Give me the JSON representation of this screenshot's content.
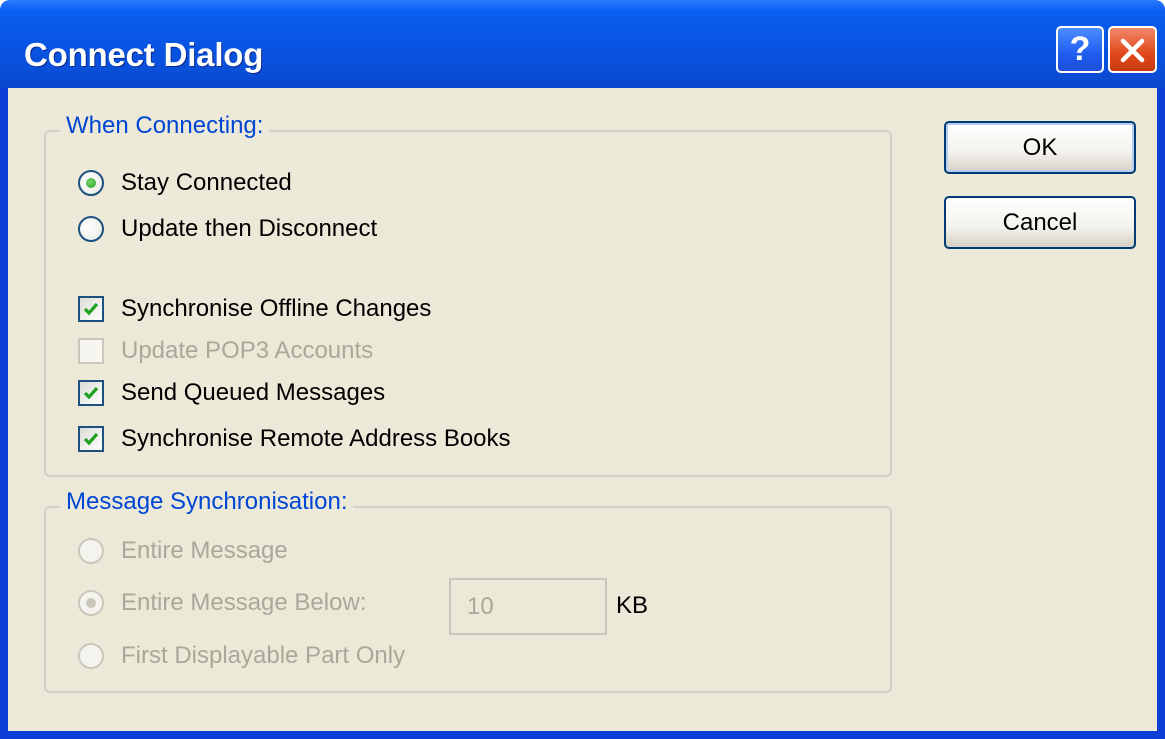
{
  "window": {
    "title": "Connect Dialog",
    "help_glyph": "?"
  },
  "when_connecting": {
    "legend": "When Connecting:",
    "stay_connected": "Stay Connected",
    "update_then_disconnect": "Update then Disconnect",
    "selected": "stay_connected",
    "sync_offline": {
      "label": "Synchronise Offline Changes",
      "checked": true,
      "enabled": true
    },
    "update_pop3": {
      "label": "Update POP3 Accounts",
      "checked": false,
      "enabled": false
    },
    "send_queued": {
      "label": "Send Queued Messages",
      "checked": true,
      "enabled": true
    },
    "sync_address_books": {
      "label": "Synchronise Remote Address Books",
      "checked": true,
      "enabled": true
    }
  },
  "message_sync": {
    "legend": "Message Synchronisation:",
    "entire_message": "Entire Message",
    "entire_message_below": "Entire Message Below:",
    "first_displayable": "First Displayable Part Only",
    "selected": "entire_message_below",
    "enabled": false,
    "size_value": "10",
    "size_unit": "KB"
  },
  "buttons": {
    "ok": "OK",
    "cancel": "Cancel"
  },
  "colors": {
    "titlebar": "#0854e3",
    "client_bg": "#ece9d8",
    "group_label": "#0046d5",
    "disabled_text": "#aca899",
    "check_mark": "#21a121",
    "close_button": "#e2481c"
  },
  "icons": {
    "help": "question-mark-icon",
    "close": "close-x-icon",
    "check": "check-mark-icon"
  }
}
